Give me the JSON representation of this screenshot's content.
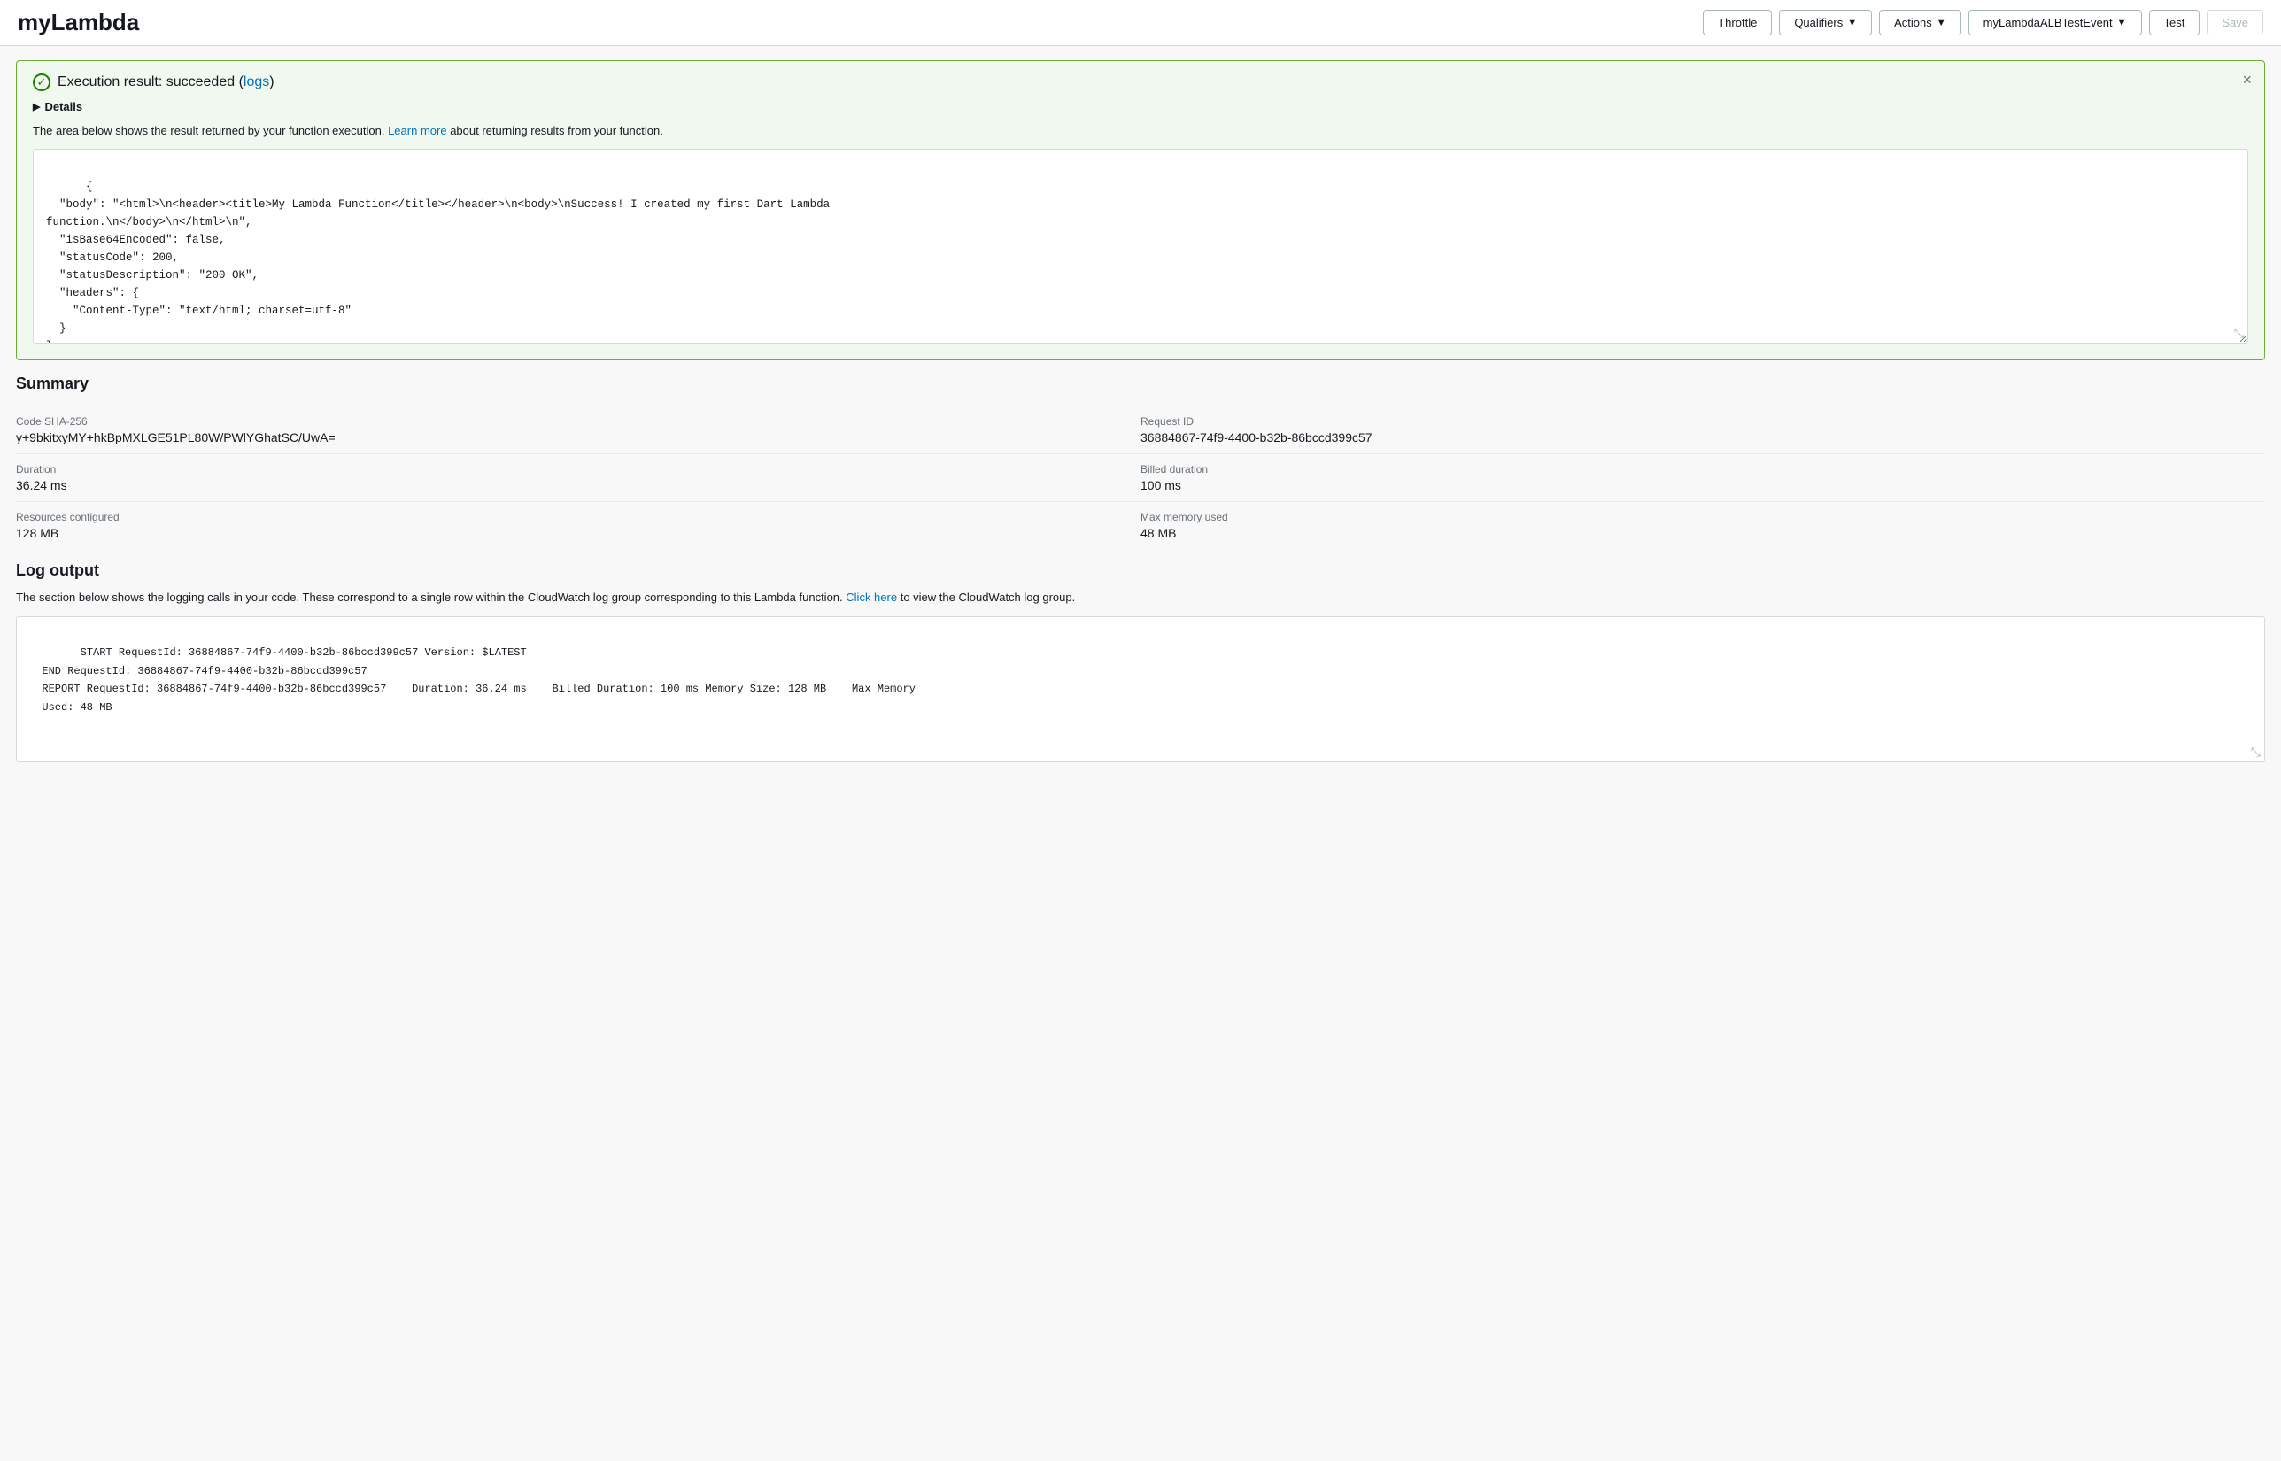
{
  "header": {
    "title": "myLambda",
    "throttle_label": "Throttle",
    "qualifiers_label": "Qualifiers",
    "actions_label": "Actions",
    "test_event_label": "myLambdaALBTestEvent",
    "test_label": "Test",
    "save_label": "Save"
  },
  "result": {
    "status_text": "Execution result: succeeded (",
    "logs_text": "logs",
    "status_close": ")",
    "details_label": "Details",
    "description": "The area below shows the result returned by your function execution.",
    "learn_more_text": "Learn more",
    "learn_more_suffix": " about returning results from your function.",
    "code_content": "{\n  \"body\": \"<html>\\n<header><title>My Lambda Function</title></header>\\n<body>\\nSuccess! I created my first Dart Lambda\nfunction.\\n</body>\\n</html>\\n\",\n  \"isBase64Encoded\": false,\n  \"statusCode\": 200,\n  \"statusDescription\": \"200 OK\",\n  \"headers\": {\n    \"Content-Type\": \"text/html; charset=utf-8\"\n  }\n}"
  },
  "summary": {
    "title": "Summary",
    "items": [
      {
        "label": "Code SHA-256",
        "value": "y+9bkitxyMY+hkBpMXLGE51PL80W/PWlYGhatSC/UwA=",
        "col": "left"
      },
      {
        "label": "Request ID",
        "value": "36884867-74f9-4400-b32b-86bccd399c57",
        "col": "right"
      },
      {
        "label": "Duration",
        "value": "36.24 ms",
        "col": "left"
      },
      {
        "label": "Billed duration",
        "value": "100 ms",
        "col": "right"
      },
      {
        "label": "Resources configured",
        "value": "128 MB",
        "col": "left"
      },
      {
        "label": "Max memory used",
        "value": "48 MB",
        "col": "right"
      }
    ]
  },
  "log_output": {
    "title": "Log output",
    "description_prefix": "The section below shows the logging calls in your code. These correspond to a single row within the CloudWatch log group corresponding to this Lambda function.",
    "click_here_text": "Click here",
    "description_suffix": " to view the CloudWatch log group.",
    "log_content": "  START RequestId: 36884867-74f9-4400-b32b-86bccd399c57 Version: $LATEST\n  END RequestId: 36884867-74f9-4400-b32b-86bccd399c57\n  REPORT RequestId: 36884867-74f9-4400-b32b-86bccd399c57    Duration: 36.24 ms    Billed Duration: 100 ms Memory Size: 128 MB    Max Memory\n  Used: 48 MB"
  },
  "icons": {
    "chevron_down": "▼",
    "chevron_right": "▶",
    "close": "×",
    "check": "✓"
  }
}
